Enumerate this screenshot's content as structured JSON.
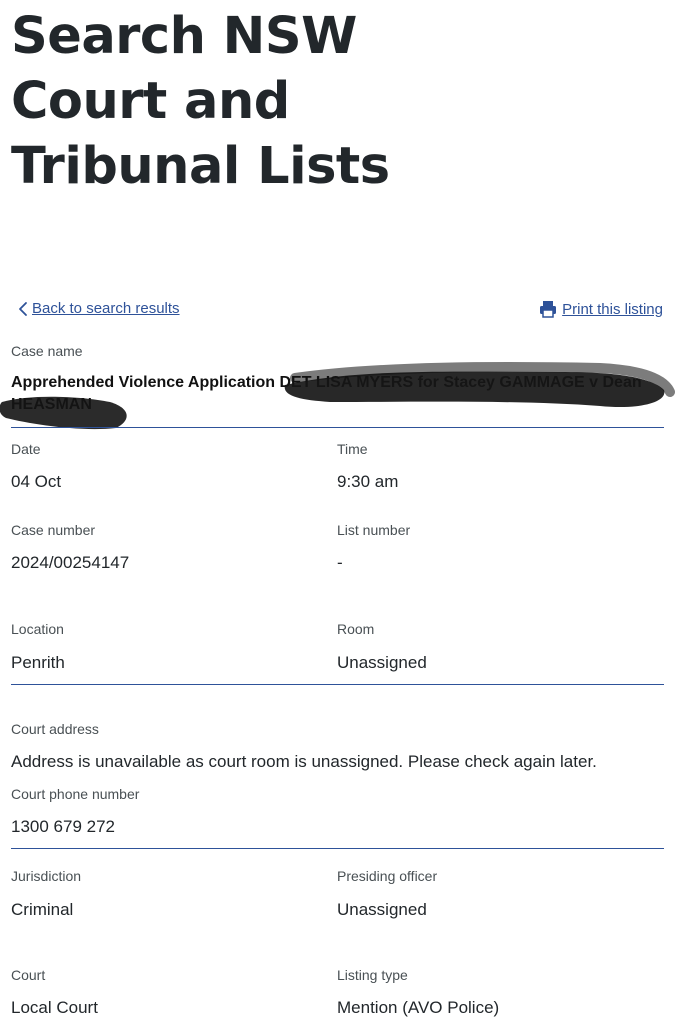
{
  "page_title": "Search NSW Court and Tribunal Lists",
  "nav": {
    "back_label": "Back to search results",
    "print_label": "Print this listing"
  },
  "case": {
    "case_name_label": "Case name",
    "case_name": "Apprehended Violence Application DET LISA MYERS for Stacey GAMMAGE v Dean HEASMAN"
  },
  "details": {
    "date_label": "Date",
    "date": "04 Oct",
    "time_label": "Time",
    "time": "9:30 am",
    "case_number_label": "Case number",
    "case_number": "2024/00254147",
    "list_number_label": "List number",
    "list_number": "-",
    "location_label": "Location",
    "location": "Penrith",
    "room_label": "Room",
    "room": "Unassigned",
    "court_address_label": "Court address",
    "court_address": "Address is unavailable as court room is unassigned. Please check again later.",
    "court_phone_label": "Court phone number",
    "court_phone": "1300 679 272",
    "jurisdiction_label": "Jurisdiction",
    "jurisdiction": "Criminal",
    "presiding_officer_label": "Presiding officer",
    "presiding_officer": "Unassigned",
    "court_label": "Court",
    "court": "Local Court",
    "listing_type_label": "Listing type",
    "listing_type": "Mention (AVO Police)"
  },
  "colors": {
    "link": "#2e5299",
    "text": "#22272b",
    "label": "#495054",
    "divider": "#2e5299"
  },
  "icons": {
    "back": "chevron-left-icon",
    "print": "printer-icon"
  }
}
